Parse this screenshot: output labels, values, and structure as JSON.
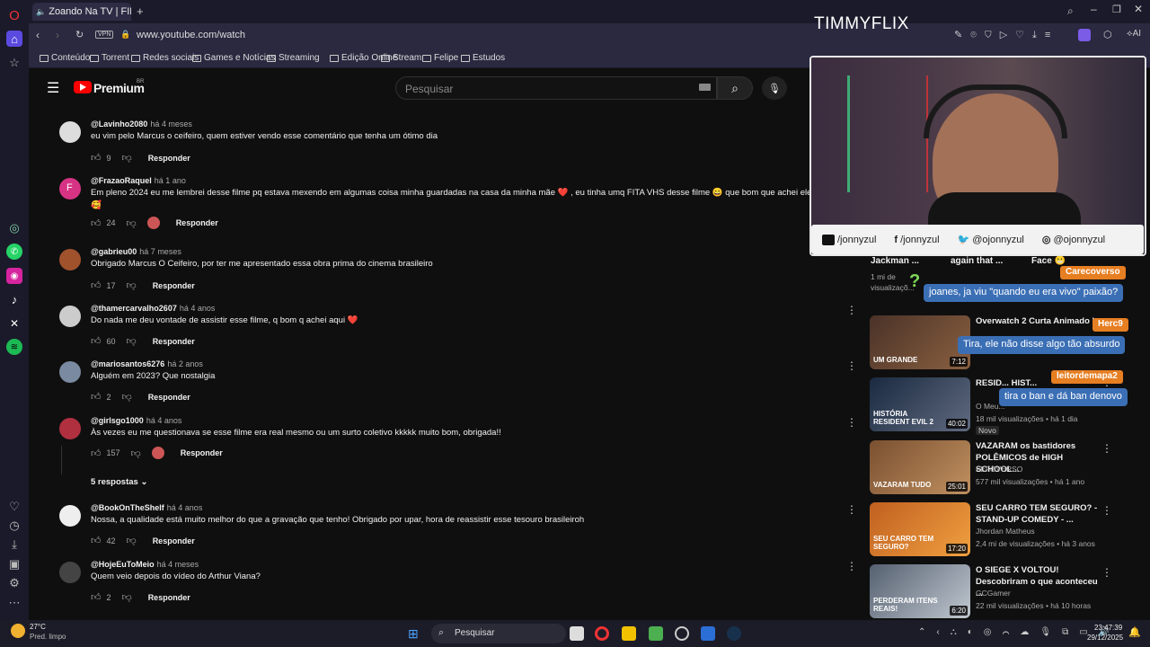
{
  "browser": {
    "tab_title": "Zoando Na TV | FILME",
    "url": "www.youtube.com/watch",
    "vpn_label": "VPN",
    "bookmarks": [
      "Conteúdo",
      "Torrent",
      "Redes sociais",
      "Games e Notícias",
      "Streaming",
      "Edição Online",
      "Stream",
      "Felipe",
      "Estudos"
    ]
  },
  "overlay": {
    "brand": "TIMMYFLIX",
    "socials": [
      "/jonnyzul",
      "/jonnyzul",
      "@ojonnyzul",
      "@ojonnyzul"
    ]
  },
  "youtube": {
    "logo": "Premium",
    "logo_region": "BR",
    "search_placeholder": "Pesquisar",
    "reply_label": "Responder",
    "comments": [
      {
        "user": "@Lavinho2080",
        "time": "há 4 meses",
        "text": "eu vim pelo Marcus o ceifeiro, quem estiver vendo esse comentário que tenha um ótimo dia",
        "likes": "9"
      },
      {
        "user": "@FrazaoRaquel",
        "time": "há 1 ano",
        "text": "Em pleno 2024 eu me lembrei desse filme pq estava mexendo em algumas coisa minha guardadas na casa da minha mãe ❤️ , eu tinha umq FITA VHS desse filme 😄 que bom que achei ele aqui",
        "text2": "🥰",
        "likes": "24"
      },
      {
        "user": "@gabrieu00",
        "time": "há 7 meses",
        "text": "Obrigado Marcus O Ceifeiro, por ter me apresentado essa obra prima do cinema brasileiro",
        "likes": "17"
      },
      {
        "user": "@thamercarvalho2607",
        "time": "há 4 anos",
        "text": "Do nada me deu vontade de assistir esse filme, q bom q achei aqui ❤️",
        "likes": "60"
      },
      {
        "user": "@mariosantos6276",
        "time": "há 2 anos",
        "text": "Alguém em 2023? Que nostalgia",
        "likes": "2"
      },
      {
        "user": "@girlsgo1000",
        "time": "há 4 anos",
        "text": "Às vezes eu me questionava se esse filme era real mesmo ou um surto coletivo kkkkk muito bom, obrigada!!",
        "likes": "157"
      },
      {
        "user": "@BookOnTheShelf",
        "time": "há 4 anos",
        "text": "Nossa, a qualidade está muito melhor do que a gravação que tenho! Obrigado por upar, hora de reassistir esse tesouro brasileiroh",
        "likes": "42"
      },
      {
        "user": "@HojeEuToMeio",
        "time": "há 4 meses",
        "text": "Quem veio depois do vídeo do Arthur Viana?",
        "likes": "2"
      }
    ],
    "replies_toggle": "5 respostas",
    "sidebar_top": [
      {
        "title": "Jackman ...",
        "meta": "1 mi de visualizaçõ..."
      },
      {
        "title": "again that ...",
        "meta": ""
      },
      {
        "title": "Face 😬",
        "meta": ""
      }
    ],
    "videos": [
      {
        "title": "Overwatch 2 Curta Animado |",
        "channel": "",
        "meta": "",
        "duration": "7:12",
        "thumb_text": "UM GRANDE"
      },
      {
        "title": "RESID... HIST...",
        "channel": "O Meu...",
        "meta": "18 mil visualizações • há 1 dia",
        "badge": "Novo",
        "duration": "40:02",
        "thumb_text": "HISTÓRIA RESIDENT EVIL 2"
      },
      {
        "title": "VAZARAM os bastidores POLÊMICOS de HIGH SCHOOL...",
        "channel": "FEFOVERSO",
        "meta": "577 mil visualizações • há 1 ano",
        "duration": "25:01",
        "thumb_text": "VAZARAM TUDO"
      },
      {
        "title": "SEU CARRO TEM SEGURO? - STAND-UP COMEDY - ...",
        "channel": "Jhordan Matheus",
        "meta": "2,4 mi de visualizações • há 3 anos",
        "duration": "17:20",
        "thumb_text": "SEU CARRO TEM SEGURO?"
      },
      {
        "title": "O SIEGE X VOLTOU! Descobriram o que aconteceu ...",
        "channel": "GCGamer",
        "meta": "22 mil visualizações • há 10 horas",
        "duration": "6:20",
        "thumb_text": "PERDERAM ITENS REAIS!"
      }
    ]
  },
  "chat": [
    {
      "name": "Carecoverso",
      "msg": "joanes, ja viu \"quando eu era vivo\" paixão?"
    },
    {
      "name": "Herc9",
      "msg": "Tira, ele não disse algo tão absurdo"
    },
    {
      "name": "leitordemapa2",
      "msg": "tira o ban e dá ban denovo"
    }
  ],
  "taskbar": {
    "weather_temp": "27°C",
    "weather_desc": "Pred. limpo",
    "search": "Pesquisar",
    "time": "23:47:39",
    "date": "29/12/2025"
  }
}
